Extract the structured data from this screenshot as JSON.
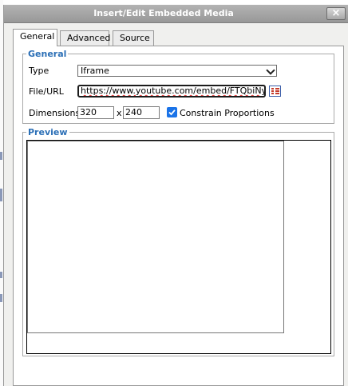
{
  "dialog": {
    "title": "Insert/Edit Embedded Media",
    "close_glyph": "×"
  },
  "tabs": [
    {
      "label": "General",
      "active": true
    },
    {
      "label": "Advanced",
      "active": false
    },
    {
      "label": "Source",
      "active": false
    }
  ],
  "general": {
    "legend": "General",
    "type_label": "Type",
    "type_value": "Iframe",
    "file_label": "File/URL",
    "file_value": "https://www.youtube.com/embed/FTQbiNyZgaY",
    "browse_icon": "browse-icon",
    "dimensions_label": "Dimensions",
    "width_value": "320",
    "separator": "x",
    "height_value": "240",
    "constrain_label": "Constrain Proportions",
    "constrain_checked": true
  },
  "preview": {
    "legend": "Preview"
  },
  "colors": {
    "legend": "#2b6fb6",
    "titlebar": "#a5a5a5",
    "checkbox": "#1a73e8"
  }
}
